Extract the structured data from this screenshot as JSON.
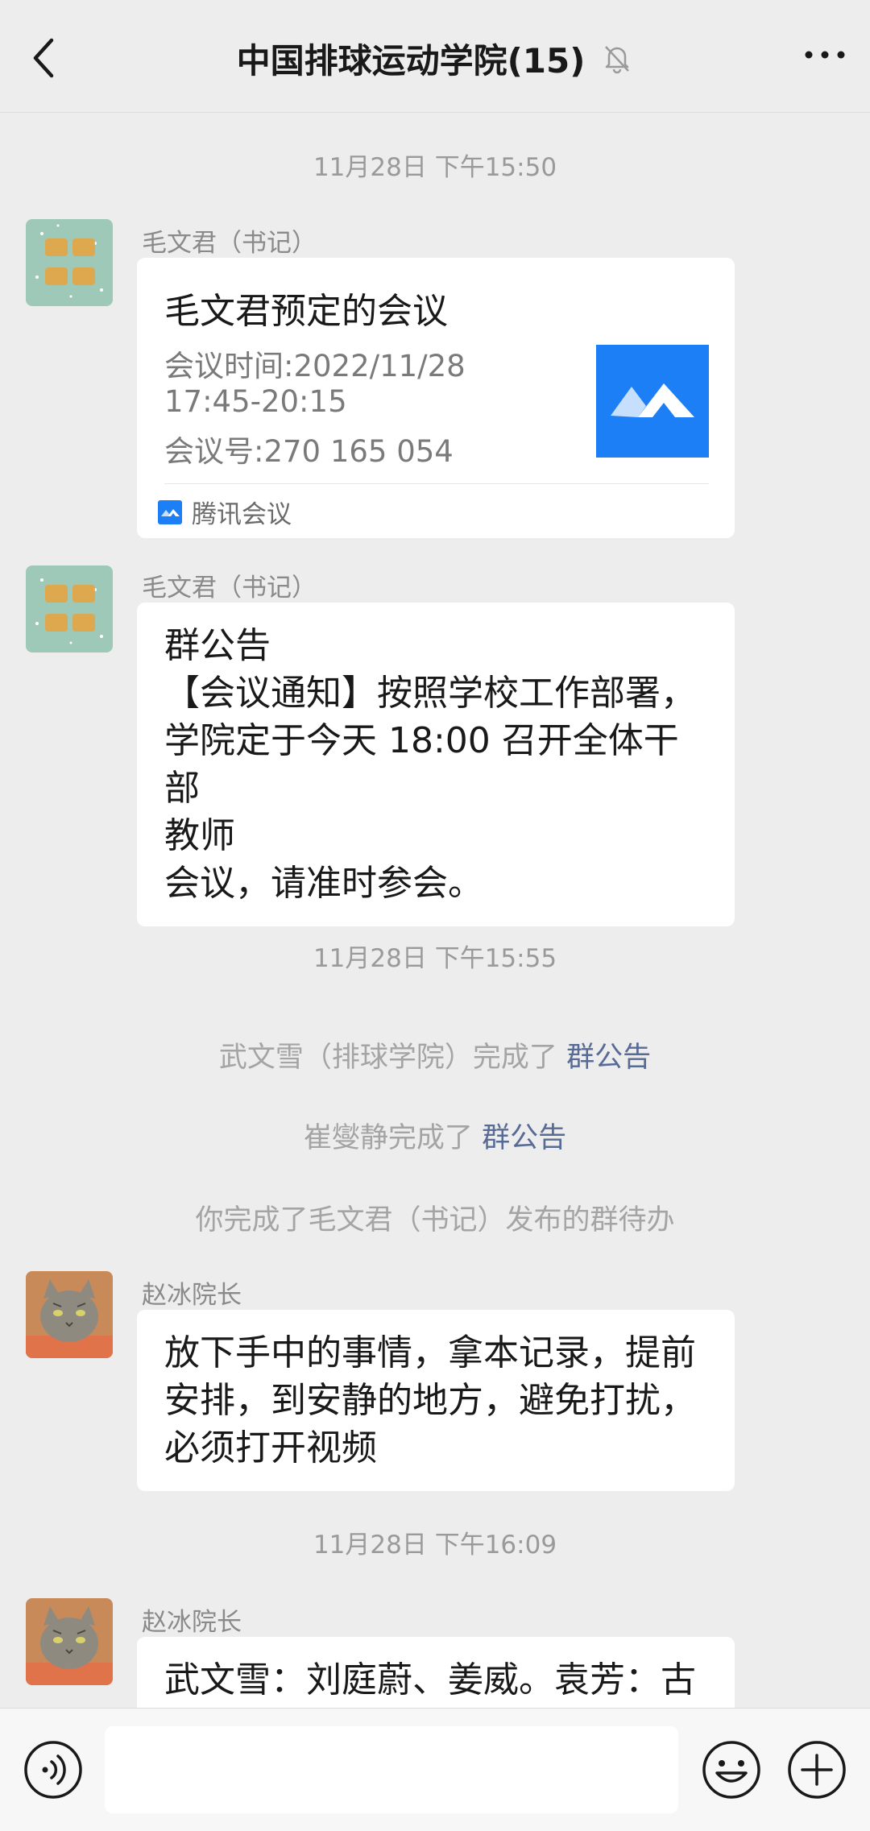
{
  "header": {
    "title": "中国排球运动学院(15)",
    "back_icon": "chevron-left-icon",
    "mute_icon": "bell-off-icon",
    "more_icon": "more-horizontal-icon"
  },
  "timestamps": [
    "11月28日 下午15:50",
    "11月28日 下午15:55",
    "11月28日 下午16:09"
  ],
  "messages": {
    "meeting": {
      "sender": "毛文君（书记）",
      "title": "毛文君预定的会议",
      "time_line1": "会议时间:2022/11/28",
      "time_line2": "17:45-20:15",
      "meeting_id": "会议号:270 165 054",
      "app_name": "腾讯会议",
      "app_icon": "tencent-meeting-icon"
    },
    "notice": {
      "sender": "毛文君（书记）",
      "text": "群公告\n【会议通知】按照学校工作部署，\n学院定于今天 18:00 召开全体干部\n教师\n会议，请准时参会。"
    },
    "dean1": {
      "sender": "赵冰院长",
      "text": "放下手中的事情，拿本记录，提前\n安排，到安静的地方，避免打扰，\n必须打开视频"
    },
    "dean2": {
      "sender": "赵冰院长",
      "text": "武文雪：刘庭蔚、姜威。袁芳：古"
    }
  },
  "system_events": [
    {
      "prefix": "武文雪（排球学院）完成了 ",
      "link": "群公告"
    },
    {
      "prefix": "崔燮静完成了 ",
      "link": "群公告"
    },
    {
      "prefix": "你完成了毛文君（书记）发布的群待办",
      "link": ""
    }
  ],
  "input_bar": {
    "voice_icon": "voice-icon",
    "emoji_icon": "emoji-icon",
    "plus_icon": "plus-circle-icon",
    "placeholder": ""
  },
  "colors": {
    "background": "#ededed",
    "bubble": "#ffffff",
    "link": "#576b95",
    "meeting_blue": "#1d7ff5"
  }
}
